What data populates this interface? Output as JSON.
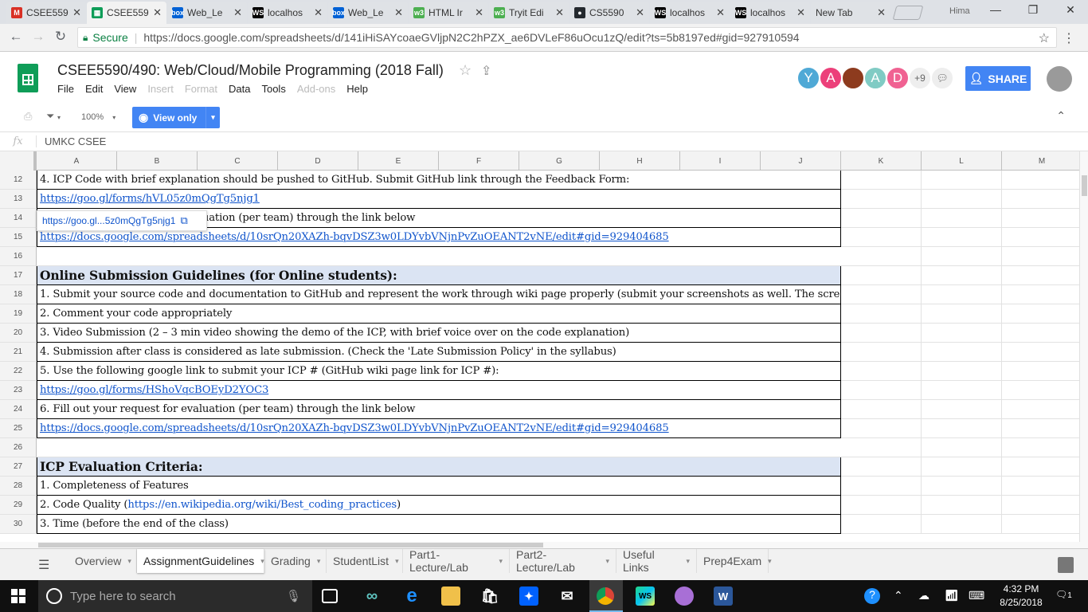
{
  "browser": {
    "tabs": [
      {
        "label": "CSEE559",
        "icon": "gmail-icon",
        "color": "#d93025",
        "glyph": "M"
      },
      {
        "label": "CSEE559",
        "icon": "sheets-icon",
        "color": "#0f9d58",
        "glyph": "▦",
        "active": true
      },
      {
        "label": "Web_Le",
        "icon": "box-icon",
        "color": "#0061d5",
        "glyph": "box"
      },
      {
        "label": "localhos",
        "icon": "webstorm-icon",
        "color": "#000000",
        "glyph": "WS"
      },
      {
        "label": "Web_Le",
        "icon": "box-icon",
        "color": "#0061d5",
        "glyph": "box"
      },
      {
        "label": "HTML Ir",
        "icon": "w3schools-icon",
        "color": "#4caf50",
        "glyph": "w3"
      },
      {
        "label": "Tryit Edi",
        "icon": "w3schools-icon",
        "color": "#4caf50",
        "glyph": "w3"
      },
      {
        "label": "CS5590",
        "icon": "github-icon",
        "color": "#24292e",
        "glyph": "●"
      },
      {
        "label": "localhos",
        "icon": "webstorm-icon",
        "color": "#000000",
        "glyph": "WS"
      },
      {
        "label": "localhos",
        "icon": "webstorm-icon",
        "color": "#000000",
        "glyph": "WS"
      },
      {
        "label": "New Tab",
        "icon": "",
        "color": "",
        "glyph": ""
      }
    ],
    "profile_name": "Hima",
    "secure_label": "Secure",
    "url": "https://docs.google.com/spreadsheets/d/141iHiSAYcoaeGVljpN2C2hPZX_ae6DVLeF86uOcu1zQ/edit?ts=5b8197ed#gid=927910594"
  },
  "doc": {
    "title": "CSEE5590/490: Web/Cloud/Mobile Programming (2018 Fall)",
    "menus": [
      {
        "label": "File",
        "enabled": true
      },
      {
        "label": "Edit",
        "enabled": true
      },
      {
        "label": "View",
        "enabled": true
      },
      {
        "label": "Insert",
        "enabled": false
      },
      {
        "label": "Format",
        "enabled": false
      },
      {
        "label": "Data",
        "enabled": true
      },
      {
        "label": "Tools",
        "enabled": true
      },
      {
        "label": "Add-ons",
        "enabled": false
      },
      {
        "label": "Help",
        "enabled": true
      }
    ],
    "collaborators": [
      {
        "letter": "Y",
        "color": "#4fa9d6"
      },
      {
        "letter": "A",
        "color": "#ec407a"
      },
      {
        "letter": "",
        "color": "#8d3b1e"
      },
      {
        "letter": "A",
        "color": "#80cbc4"
      },
      {
        "letter": "D",
        "color": "#f06292"
      }
    ],
    "more_collaborators": "+9",
    "share_label": "SHARE"
  },
  "toolbar": {
    "zoom": "100%",
    "view_only_label": "View only"
  },
  "formula_bar": {
    "fx": "fx",
    "value": "UMKC CSEE"
  },
  "columns": [
    "A",
    "B",
    "C",
    "D",
    "E",
    "F",
    "G",
    "H",
    "I",
    "J",
    "K",
    "L",
    "M"
  ],
  "rows": [
    {
      "num": "12",
      "text": "4. ICP Code with brief explanation should be pushed to GitHub. Submit GitHub link through the Feedback Form:",
      "style": "text"
    },
    {
      "num": "13",
      "text": "https://goo.gl/forms/hVL05z0mQgTg5njg1",
      "style": "link"
    },
    {
      "num": "14",
      "text": "6. Fill out your request for evaluation (per team) through the link below",
      "style": "text"
    },
    {
      "num": "15",
      "text": "https://docs.google.com/spreadsheets/d/10srQn20XAZh-bqvDSZ3w0LDYvbVNjnPvZuOEANT2vNE/edit#gid=929404685",
      "style": "link"
    },
    {
      "num": "16",
      "text": "",
      "style": "empty"
    },
    {
      "num": "17",
      "text": "Online Submission Guidelines (for Online students):",
      "style": "header"
    },
    {
      "num": "18",
      "text": "1. Submit your source code and documentation to GitHub and represent the work through wiki page properly (submit your screenshots as well. The scre",
      "style": "text"
    },
    {
      "num": "19",
      "text": "2. Comment your code appropriately",
      "style": "text"
    },
    {
      "num": "20",
      "text": "3. Video Submission (2 – 3 min video showing the demo of the ICP, with brief voice over on the code explanation)",
      "style": "text"
    },
    {
      "num": "21",
      "text": "4. Submission after class is considered as late submission. (Check the 'Late Submission Policy' in the syllabus)",
      "style": "text"
    },
    {
      "num": "22",
      "text": "5. Use the following google link to submit your ICP # (GitHub wiki page link for ICP #):",
      "style": "text"
    },
    {
      "num": "23",
      "text": "https://goo.gl/forms/HShoVqcBOEyD2YOC3",
      "style": "link"
    },
    {
      "num": "24",
      "text": "6. Fill out your request for evaluation (per team) through the link below",
      "style": "text"
    },
    {
      "num": "25",
      "text": "https://docs.google.com/spreadsheets/d/10srQn20XAZh-bqvDSZ3w0LDYvbVNjnPvZuOEANT2vNE/edit#gid=929404685",
      "style": "link"
    },
    {
      "num": "26",
      "text": "",
      "style": "empty"
    },
    {
      "num": "27",
      "text": "ICP Evaluation Criteria:",
      "style": "header"
    },
    {
      "num": "28",
      "text": "1. Completeness of Features",
      "style": "text"
    },
    {
      "num": "29",
      "text_before": "2. Code Quality (",
      "link_text": "https://en.wikipedia.org/wiki/Best_coding_practices",
      "text_after": ")",
      "style": "mixed"
    },
    {
      "num": "30",
      "text": "3. Time (before the end of the class)",
      "style": "text"
    }
  ],
  "link_tooltip": "https://goo.gl...5z0mQgTg5njg1",
  "sheet_tabs": [
    {
      "label": "Overview",
      "active": false
    },
    {
      "label": "AssignmentGuidelines",
      "active": true
    },
    {
      "label": "Grading",
      "active": false
    },
    {
      "label": "StudentList",
      "active": false
    },
    {
      "label": "Part1-Lecture/Lab",
      "active": false
    },
    {
      "label": "Part2-Lecture/Lab",
      "active": false
    },
    {
      "label": "Useful Links",
      "active": false
    },
    {
      "label": "Prep4Exam",
      "active": false
    }
  ],
  "taskbar": {
    "search_placeholder": "Type here to search",
    "time": "4:32 PM",
    "date": "8/25/2018",
    "notifications": "1"
  }
}
